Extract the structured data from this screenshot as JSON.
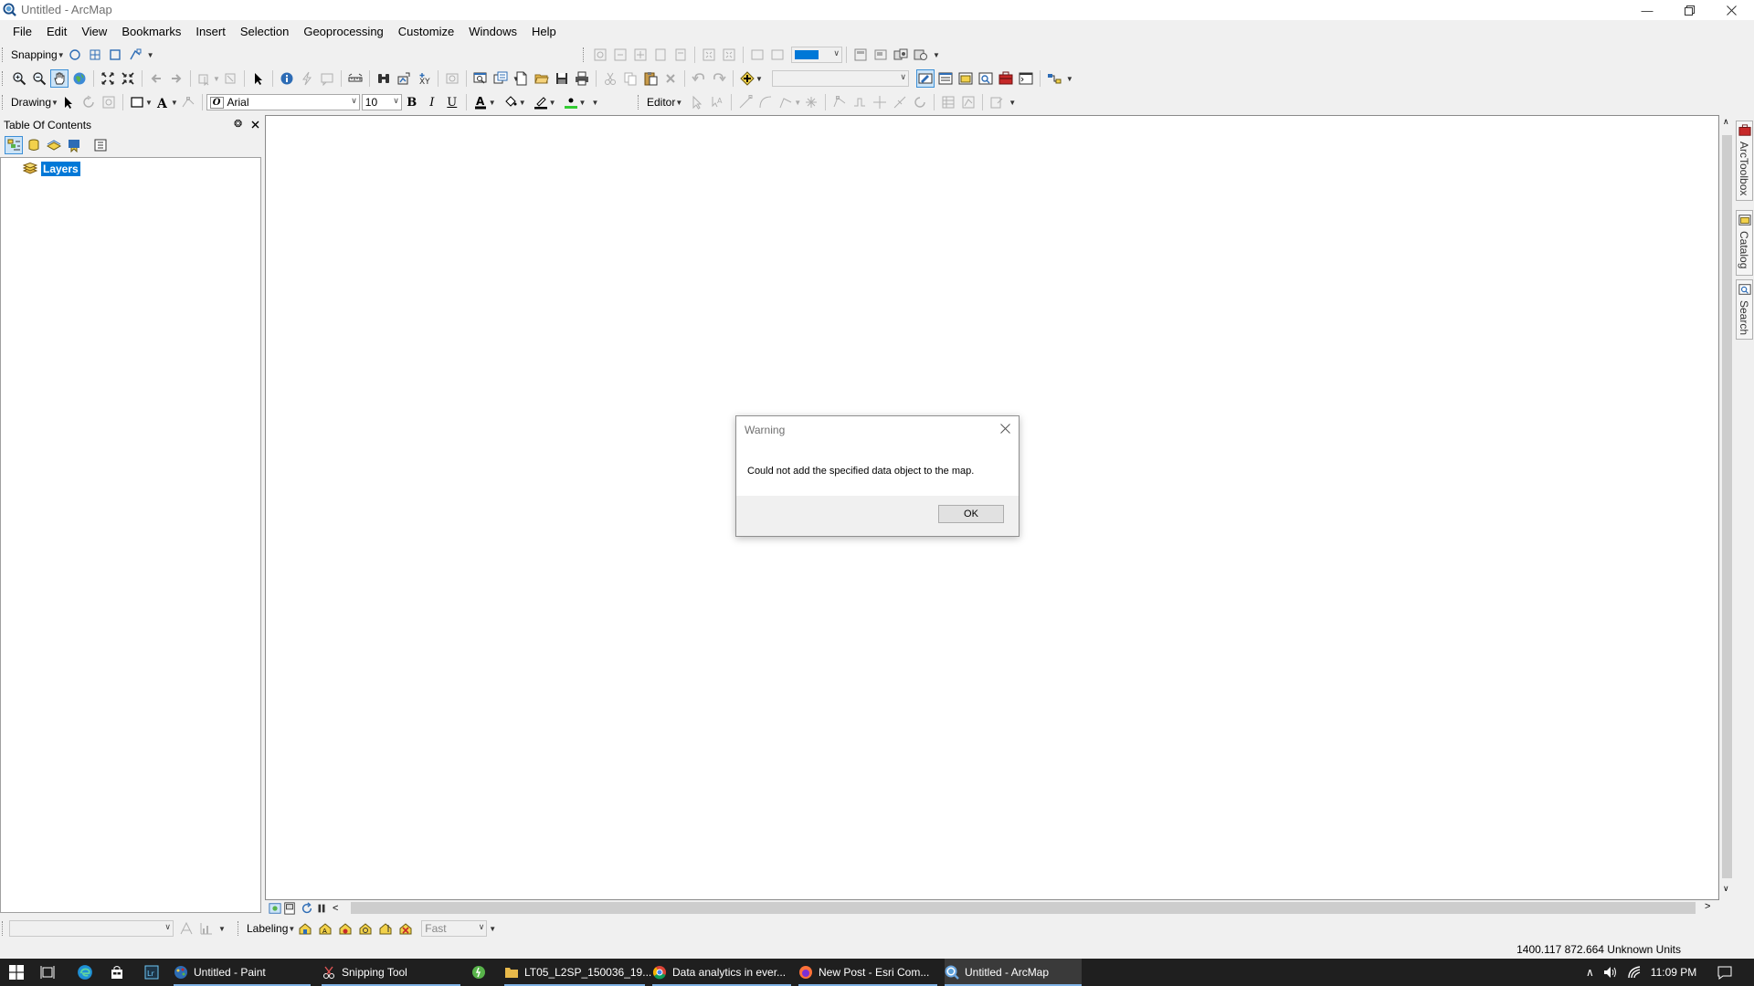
{
  "window": {
    "title": "Untitled - ArcMap"
  },
  "menu": [
    "File",
    "Edit",
    "View",
    "Bookmarks",
    "Insert",
    "Selection",
    "Geoprocessing",
    "Customize",
    "Windows",
    "Help"
  ],
  "toolbars": {
    "snapping_label": "Snapping",
    "drawing_label": "Drawing",
    "font_name": "Arial",
    "font_size": "10",
    "editor_label": "Editor",
    "labeling_label": "Labeling",
    "labeling_speed": "Fast"
  },
  "toc": {
    "title": "Table Of Contents",
    "layers_label": "Layers"
  },
  "dock_tabs": [
    "ArcToolbox",
    "Catalog",
    "Search"
  ],
  "dialog": {
    "title": "Warning",
    "message": "Could not add the specified data object to the map.",
    "ok_label": "OK"
  },
  "status": {
    "coordinates": "1400.117  872.664 Unknown Units"
  },
  "taskbar": {
    "items": [
      {
        "label": "Untitled - Paint",
        "icon": "paint-icon"
      },
      {
        "label": "Snipping Tool",
        "icon": "snipping-tool-icon"
      },
      {
        "label": "LT05_L2SP_150036_19...",
        "icon": "folder-icon"
      },
      {
        "label": "Data analytics in ever...",
        "icon": "chrome-icon"
      },
      {
        "label": "New Post - Esri Com...",
        "icon": "firefox-icon"
      },
      {
        "label": "Untitled - ArcMap",
        "icon": "arcmap-icon"
      }
    ],
    "time": "11:09 PM"
  },
  "colors": {
    "accent": "#0078d7",
    "taskbar": "#1f1f1f",
    "chrome": "#f0f0f0"
  }
}
